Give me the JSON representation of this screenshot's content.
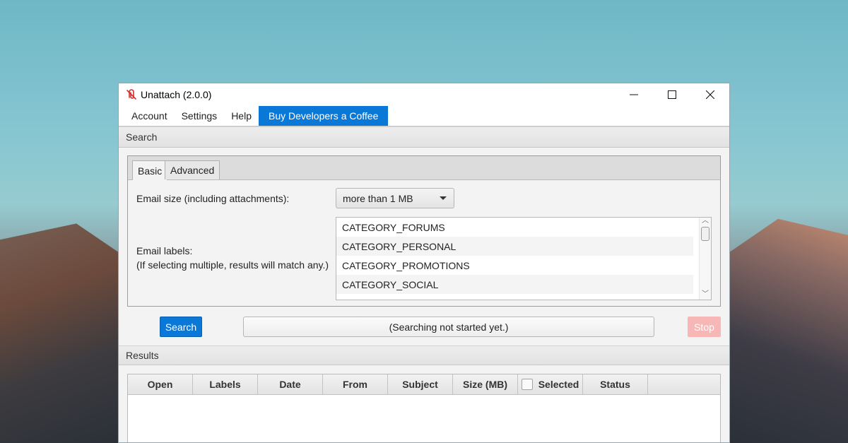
{
  "window": {
    "title": "Unattach (2.0.0)",
    "controls": {
      "minimize": "—",
      "maximize": "☐",
      "close": "✕"
    }
  },
  "menu": [
    "Account",
    "Settings",
    "Help",
    "Buy Developers a Coffee"
  ],
  "search_section": {
    "title": "Search",
    "tabs": [
      "Basic",
      "Advanced"
    ],
    "active_tab": "Basic",
    "email_size_label": "Email size (including attachments):",
    "email_size_value": "more than 1 MB",
    "email_labels_label": "Email labels:",
    "email_labels_hint": "(If selecting multiple, results will match any.)",
    "labels": [
      "CATEGORY_FORUMS",
      "CATEGORY_PERSONAL",
      "CATEGORY_PROMOTIONS",
      "CATEGORY_SOCIAL"
    ],
    "search_button": "Search",
    "status_text": "(Searching not started yet.)",
    "stop_button": "Stop"
  },
  "results_section": {
    "title": "Results",
    "columns": [
      "Open",
      "Labels",
      "Date",
      "From",
      "Subject",
      "Size (MB)",
      "Selected",
      "Status"
    ]
  },
  "colors": {
    "accent": "#0a78d7",
    "stop_disabled": "#f6b7b6",
    "app_icon": "#d32f2f"
  }
}
